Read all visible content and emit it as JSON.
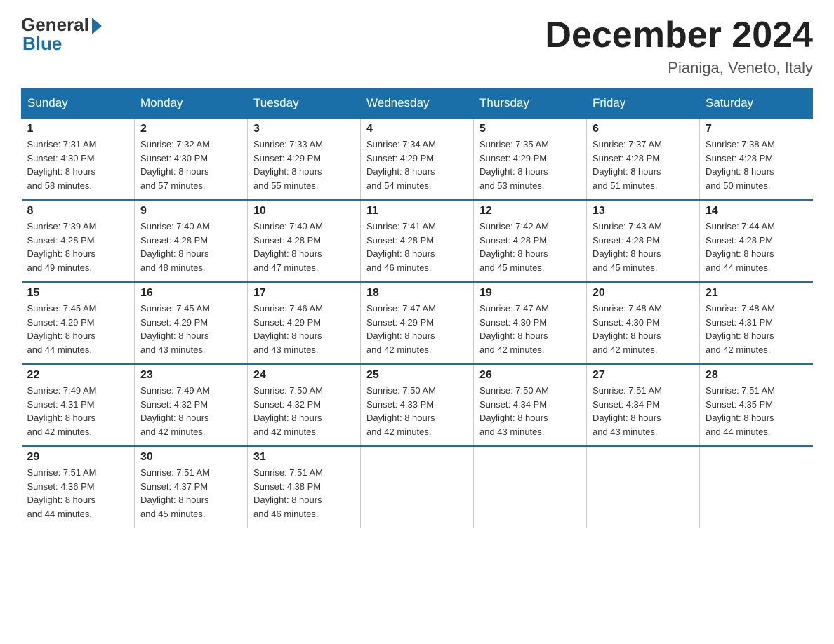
{
  "header": {
    "logo_general": "General",
    "logo_blue": "Blue",
    "month_title": "December 2024",
    "location": "Pianiga, Veneto, Italy"
  },
  "weekdays": [
    "Sunday",
    "Monday",
    "Tuesday",
    "Wednesday",
    "Thursday",
    "Friday",
    "Saturday"
  ],
  "weeks": [
    [
      {
        "day": "1",
        "sunrise": "7:31 AM",
        "sunset": "4:30 PM",
        "daylight": "8 hours and 58 minutes."
      },
      {
        "day": "2",
        "sunrise": "7:32 AM",
        "sunset": "4:30 PM",
        "daylight": "8 hours and 57 minutes."
      },
      {
        "day": "3",
        "sunrise": "7:33 AM",
        "sunset": "4:29 PM",
        "daylight": "8 hours and 55 minutes."
      },
      {
        "day": "4",
        "sunrise": "7:34 AM",
        "sunset": "4:29 PM",
        "daylight": "8 hours and 54 minutes."
      },
      {
        "day": "5",
        "sunrise": "7:35 AM",
        "sunset": "4:29 PM",
        "daylight": "8 hours and 53 minutes."
      },
      {
        "day": "6",
        "sunrise": "7:37 AM",
        "sunset": "4:28 PM",
        "daylight": "8 hours and 51 minutes."
      },
      {
        "day": "7",
        "sunrise": "7:38 AM",
        "sunset": "4:28 PM",
        "daylight": "8 hours and 50 minutes."
      }
    ],
    [
      {
        "day": "8",
        "sunrise": "7:39 AM",
        "sunset": "4:28 PM",
        "daylight": "8 hours and 49 minutes."
      },
      {
        "day": "9",
        "sunrise": "7:40 AM",
        "sunset": "4:28 PM",
        "daylight": "8 hours and 48 minutes."
      },
      {
        "day": "10",
        "sunrise": "7:40 AM",
        "sunset": "4:28 PM",
        "daylight": "8 hours and 47 minutes."
      },
      {
        "day": "11",
        "sunrise": "7:41 AM",
        "sunset": "4:28 PM",
        "daylight": "8 hours and 46 minutes."
      },
      {
        "day": "12",
        "sunrise": "7:42 AM",
        "sunset": "4:28 PM",
        "daylight": "8 hours and 45 minutes."
      },
      {
        "day": "13",
        "sunrise": "7:43 AM",
        "sunset": "4:28 PM",
        "daylight": "8 hours and 45 minutes."
      },
      {
        "day": "14",
        "sunrise": "7:44 AM",
        "sunset": "4:28 PM",
        "daylight": "8 hours and 44 minutes."
      }
    ],
    [
      {
        "day": "15",
        "sunrise": "7:45 AM",
        "sunset": "4:29 PM",
        "daylight": "8 hours and 44 minutes."
      },
      {
        "day": "16",
        "sunrise": "7:45 AM",
        "sunset": "4:29 PM",
        "daylight": "8 hours and 43 minutes."
      },
      {
        "day": "17",
        "sunrise": "7:46 AM",
        "sunset": "4:29 PM",
        "daylight": "8 hours and 43 minutes."
      },
      {
        "day": "18",
        "sunrise": "7:47 AM",
        "sunset": "4:29 PM",
        "daylight": "8 hours and 42 minutes."
      },
      {
        "day": "19",
        "sunrise": "7:47 AM",
        "sunset": "4:30 PM",
        "daylight": "8 hours and 42 minutes."
      },
      {
        "day": "20",
        "sunrise": "7:48 AM",
        "sunset": "4:30 PM",
        "daylight": "8 hours and 42 minutes."
      },
      {
        "day": "21",
        "sunrise": "7:48 AM",
        "sunset": "4:31 PM",
        "daylight": "8 hours and 42 minutes."
      }
    ],
    [
      {
        "day": "22",
        "sunrise": "7:49 AM",
        "sunset": "4:31 PM",
        "daylight": "8 hours and 42 minutes."
      },
      {
        "day": "23",
        "sunrise": "7:49 AM",
        "sunset": "4:32 PM",
        "daylight": "8 hours and 42 minutes."
      },
      {
        "day": "24",
        "sunrise": "7:50 AM",
        "sunset": "4:32 PM",
        "daylight": "8 hours and 42 minutes."
      },
      {
        "day": "25",
        "sunrise": "7:50 AM",
        "sunset": "4:33 PM",
        "daylight": "8 hours and 42 minutes."
      },
      {
        "day": "26",
        "sunrise": "7:50 AM",
        "sunset": "4:34 PM",
        "daylight": "8 hours and 43 minutes."
      },
      {
        "day": "27",
        "sunrise": "7:51 AM",
        "sunset": "4:34 PM",
        "daylight": "8 hours and 43 minutes."
      },
      {
        "day": "28",
        "sunrise": "7:51 AM",
        "sunset": "4:35 PM",
        "daylight": "8 hours and 44 minutes."
      }
    ],
    [
      {
        "day": "29",
        "sunrise": "7:51 AM",
        "sunset": "4:36 PM",
        "daylight": "8 hours and 44 minutes."
      },
      {
        "day": "30",
        "sunrise": "7:51 AM",
        "sunset": "4:37 PM",
        "daylight": "8 hours and 45 minutes."
      },
      {
        "day": "31",
        "sunrise": "7:51 AM",
        "sunset": "4:38 PM",
        "daylight": "8 hours and 46 minutes."
      },
      null,
      null,
      null,
      null
    ]
  ],
  "labels": {
    "sunrise": "Sunrise:",
    "sunset": "Sunset:",
    "daylight": "Daylight:"
  }
}
